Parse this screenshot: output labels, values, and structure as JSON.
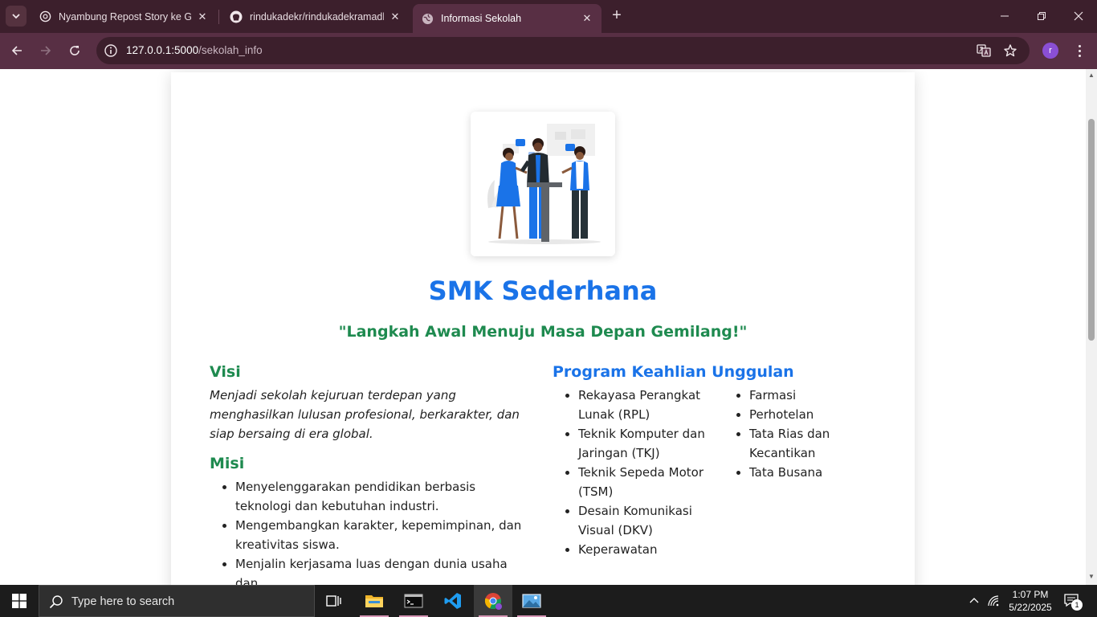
{
  "browser": {
    "tabs": [
      {
        "title": "Nyambung Repost Story ke GitHub",
        "icon": "chatgpt-icon",
        "active": false
      },
      {
        "title": "rindukadekr/rindukadekramadh",
        "icon": "github-icon",
        "active": false
      },
      {
        "title": "Informasi Sekolah",
        "icon": "globe-icon",
        "active": true
      }
    ],
    "new_tab_label": "+",
    "close_label": "✕",
    "url": {
      "host": "127.0.0.1:5000",
      "path": "/sekolah_info"
    },
    "profile_initial": "r"
  },
  "page": {
    "school_name": "SMK Sederhana",
    "motto": "\"Langkah Awal Menuju Masa Depan Gemilang!\"",
    "visi": {
      "heading": "Visi",
      "text": "Menjadi sekolah kejuruan terdepan yang menghasilkan lulusan profesional, berkarakter, dan siap bersaing di era global."
    },
    "misi": {
      "heading": "Misi",
      "items": [
        "Menyelenggarakan pendidikan berbasis teknologi dan kebutuhan industri.",
        "Mengembangkan karakter, kepemimpinan, dan kreativitas siswa.",
        "Menjalin kerjasama luas dengan dunia usaha dan"
      ]
    },
    "program": {
      "heading": "Program Keahlian Unggulan",
      "column1": [
        "Rekayasa Perangkat Lunak (RPL)",
        "Teknik Komputer dan Jaringan (TKJ)",
        "Teknik Sepeda Motor (TSM)",
        "Desain Komunikasi Visual (DKV)",
        "Keperawatan"
      ],
      "column2": [
        "Farmasi",
        "Perhotelan",
        "Tata Rias dan Kecantikan",
        "Tata Busana"
      ]
    }
  },
  "taskbar": {
    "search_placeholder": "Type here to search",
    "time": "1:07 PM",
    "date": "5/22/2025",
    "notification_count": "1"
  },
  "colors": {
    "title_blue": "#1a73e8",
    "heading_green": "#1e8a4f",
    "chrome_dark": "#3c1f2c",
    "chrome_toolbar": "#582f44"
  }
}
